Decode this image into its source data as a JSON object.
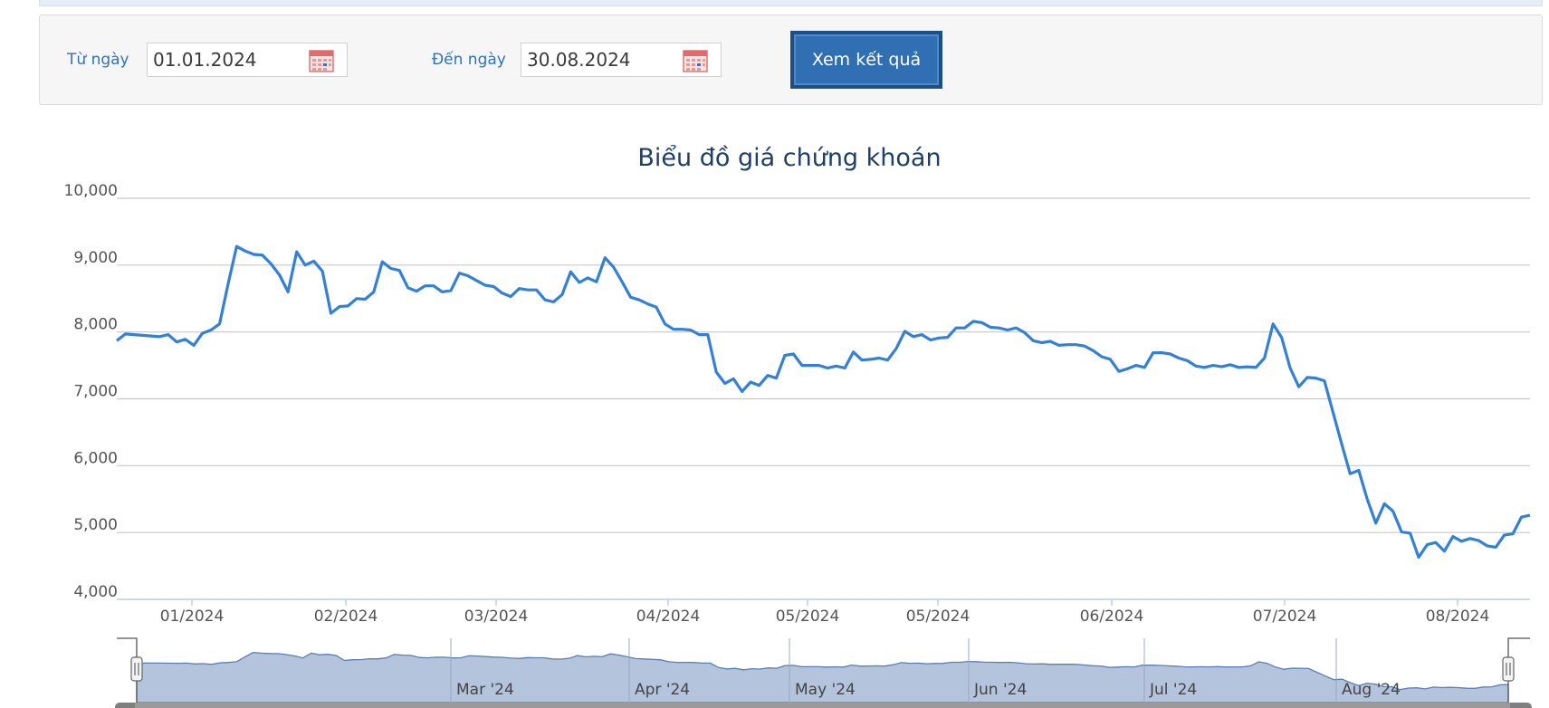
{
  "filters": {
    "from_label": "Từ ngày",
    "from_value": "01.01.2024",
    "to_label": "Đến ngày",
    "to_value": "30.08.2024",
    "submit_label": "Xem kết quả"
  },
  "colors": {
    "accent": "#2f6fb2",
    "label": "#2f74b8",
    "series": "#3480d3",
    "navigator_fill": "#b3c4dc",
    "navigator_line": "#5a7fb0",
    "grid": "#c8c8c8"
  },
  "chart_data": {
    "type": "line",
    "title": "Biểu đồ giá chứng khoán",
    "xlabel": "",
    "ylabel": "",
    "ylim": [
      4000,
      10000
    ],
    "y_ticks": [
      "10,000",
      "9,000",
      "8,000",
      "7,000",
      "6,000",
      "5,000",
      "4,000"
    ],
    "x_tick_labels": [
      "01/2024",
      "02/2024",
      "03/2024",
      "04/2024",
      "05/2024",
      "05/2024",
      "06/2024",
      "07/2024",
      "08/2024"
    ],
    "grid": true,
    "legend": "none",
    "series": [
      {
        "values": [
          7870,
          7970,
          7960,
          7950,
          7940,
          7930,
          7960,
          7850,
          7890,
          7800,
          7980,
          8030,
          8120,
          8720,
          9280,
          9210,
          9160,
          9150,
          9020,
          8850,
          8600,
          9200,
          9000,
          9060,
          8910,
          8280,
          8380,
          8390,
          8500,
          8490,
          8600,
          9050,
          8950,
          8920,
          8660,
          8610,
          8690,
          8690,
          8600,
          8620,
          8880,
          8840,
          8770,
          8700,
          8680,
          8580,
          8530,
          8650,
          8630,
          8630,
          8480,
          8450,
          8560,
          8900,
          8740,
          8810,
          8750,
          9110,
          8970,
          8750,
          8520,
          8480,
          8420,
          8370,
          8120,
          8040,
          8040,
          8030,
          7960,
          7960,
          7400,
          7230,
          7300,
          7110,
          7250,
          7200,
          7350,
          7310,
          7650,
          7670,
          7500,
          7500,
          7500,
          7460,
          7490,
          7460,
          7700,
          7580,
          7590,
          7610,
          7580,
          7750,
          8010,
          7930,
          7960,
          7880,
          7910,
          7920,
          8060,
          8060,
          8160,
          8140,
          8070,
          8060,
          8030,
          8060,
          7990,
          7870,
          7840,
          7860,
          7800,
          7810,
          7810,
          7790,
          7720,
          7630,
          7590,
          7410,
          7450,
          7500,
          7470,
          7690,
          7690,
          7670,
          7610,
          7570,
          7490,
          7470,
          7500,
          7480,
          7510,
          7470,
          7480,
          7470,
          7610,
          8120,
          7920,
          7460,
          7180,
          7320,
          7310,
          7270,
          6800,
          6330,
          5880,
          5930,
          5500,
          5140,
          5430,
          5320,
          5010,
          4990,
          4630,
          4820,
          4850,
          4720,
          4940,
          4870,
          4910,
          4880,
          4800,
          4780,
          4960,
          4980,
          5230,
          5260
        ]
      }
    ],
    "navigator": {
      "labels": [
        "Mar '24",
        "Apr '24",
        "May '24",
        "Jun '24",
        "Jul '24",
        "Aug '24"
      ]
    }
  }
}
